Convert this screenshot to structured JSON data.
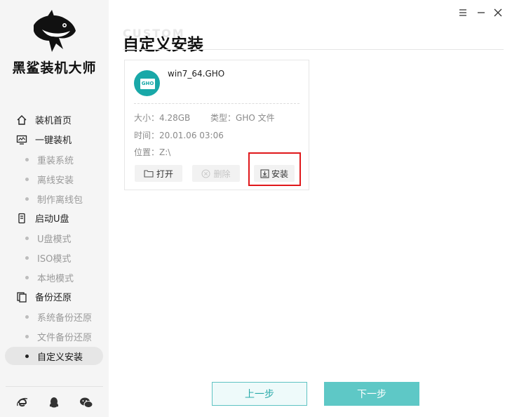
{
  "app": {
    "brand": "黑鲨装机大师",
    "watermark": "CUSTOM"
  },
  "sidebar": {
    "groups": [
      {
        "label": "装机首页",
        "icon": "home-icon"
      },
      {
        "label": "一键装机",
        "icon": "monitor-icon",
        "items": [
          "重装系统",
          "离线安装",
          "制作离线包"
        ]
      },
      {
        "label": "启动U盘",
        "icon": "usb-icon",
        "items": [
          "U盘模式",
          "ISO模式",
          "本地模式"
        ]
      },
      {
        "label": "备份还原",
        "icon": "backup-icon",
        "items": [
          "系统备份还原",
          "文件备份还原",
          "自定义安装"
        ]
      }
    ],
    "active_item": "自定义安装",
    "footer_icons": [
      "ie-browser-icon",
      "qq-icon",
      "wechat-icon"
    ]
  },
  "main": {
    "title": "自定义安装",
    "file": {
      "name": "win7_64.GHO",
      "badge": "GHO",
      "size_label": "大小：",
      "size": "4.28GB",
      "type_label": "类型：",
      "type": "GHO 文件",
      "time_label": "时间：",
      "time": "20.01.06 03:06",
      "location_label": "位置：",
      "location": "Z:\\"
    },
    "actions": {
      "open": "打开",
      "delete": "删除",
      "install": "安装"
    }
  },
  "footer": {
    "prev": "上一步",
    "next": "下一步"
  },
  "colors": {
    "accent": "#19a8a8",
    "highlight": "#e0181b"
  }
}
